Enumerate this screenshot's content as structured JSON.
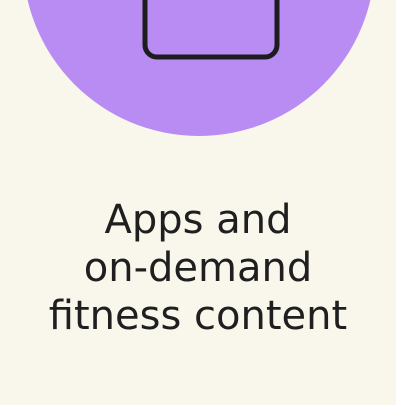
{
  "feature": {
    "icon": "device-icon",
    "title_lines": [
      "Apps and",
      "on-demand",
      "fitness content"
    ]
  },
  "colors": {
    "background": "#f9f7ec",
    "circle": "#b88cf2",
    "icon_stroke": "#1d1d1f",
    "text": "#1f1f1f"
  }
}
